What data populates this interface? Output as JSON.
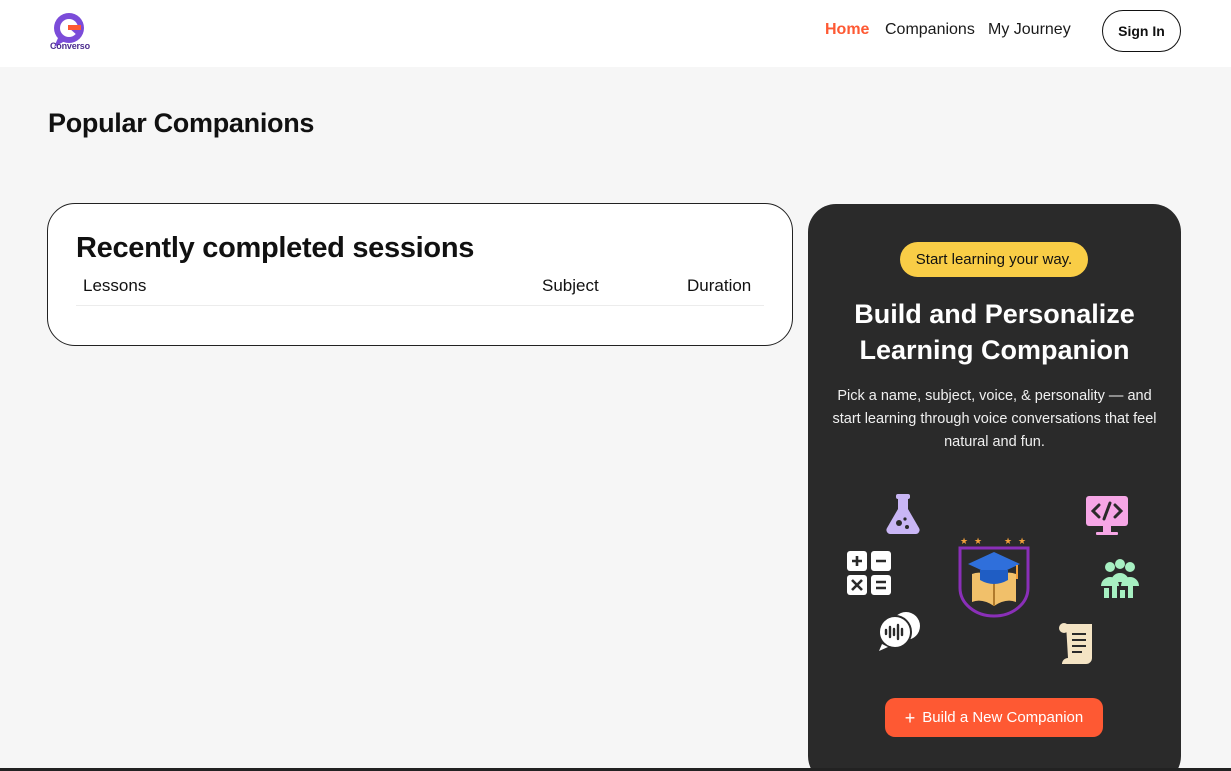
{
  "header": {
    "logo_text": "Converso",
    "nav": [
      {
        "label": "Home",
        "active": true
      },
      {
        "label": "Companions",
        "active": false
      },
      {
        "label": "My Journey",
        "active": false
      }
    ],
    "signin_label": "Sign In"
  },
  "main": {
    "page_title": "Popular Companions",
    "sessions": {
      "title": "Recently completed sessions",
      "columns": [
        "Lessons",
        "Subject",
        "Duration"
      ],
      "rows": []
    }
  },
  "cta": {
    "badge": "Start learning your way.",
    "title": "Build and Personalize Learning Companion",
    "description": "Pick a name, subject, voice, & personality — and start learning through voice conversations that feel natural and fun.",
    "button_icon": "plus-icon",
    "button_label": "Build a New Companion",
    "icons": [
      "flask-icon",
      "code-monitor-icon",
      "calculator-icon",
      "graduation-cap-book-icon",
      "people-chart-icon",
      "voice-chat-icon",
      "scroll-icon"
    ]
  },
  "colors": {
    "accent": "#fe5933",
    "badge": "#f9cd46",
    "cta_bg": "#2a2a2a",
    "page_bg": "#f6f6f6",
    "brand_purple": "#7b4cd9"
  }
}
